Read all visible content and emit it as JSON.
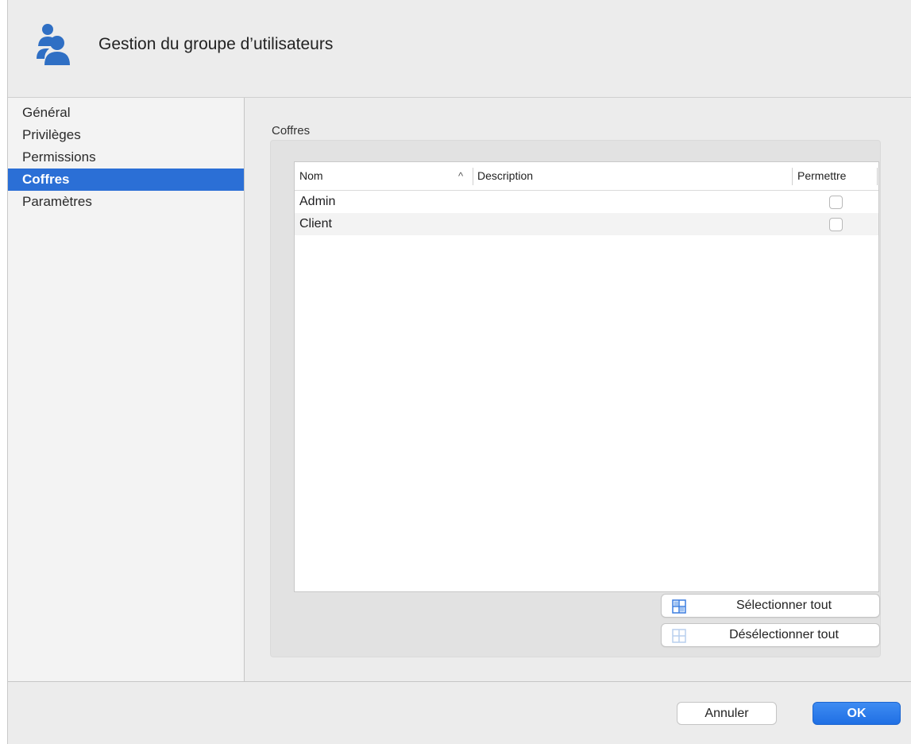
{
  "window": {
    "title": "Gestion du groupe d’utilisateurs",
    "icon": "users-group-icon",
    "accent_color": "#2b6fd6"
  },
  "sidebar": {
    "selected": "Coffres",
    "items": [
      {
        "label": "Général"
      },
      {
        "label": "Privilèges"
      },
      {
        "label": "Permissions"
      },
      {
        "label": "Coffres"
      },
      {
        "label": "Paramètres"
      }
    ]
  },
  "main": {
    "group_label": "Coffres",
    "table": {
      "columns": [
        "Nom",
        "Description",
        "Permettre"
      ],
      "sort_indicator": "^",
      "sorted_column": "Nom",
      "rows": [
        {
          "name": "Admin",
          "description": "",
          "allowed": false
        },
        {
          "name": "Client",
          "description": "",
          "allowed": false
        }
      ]
    },
    "select_all_label": "Sélectionner tout",
    "select_all_icon": "select-all-icon",
    "deselect_all_label": "Désélectionner tout",
    "deselect_all_icon": "deselect-all-icon"
  },
  "footer": {
    "cancel_label": "Annuler",
    "ok_label": "OK"
  }
}
